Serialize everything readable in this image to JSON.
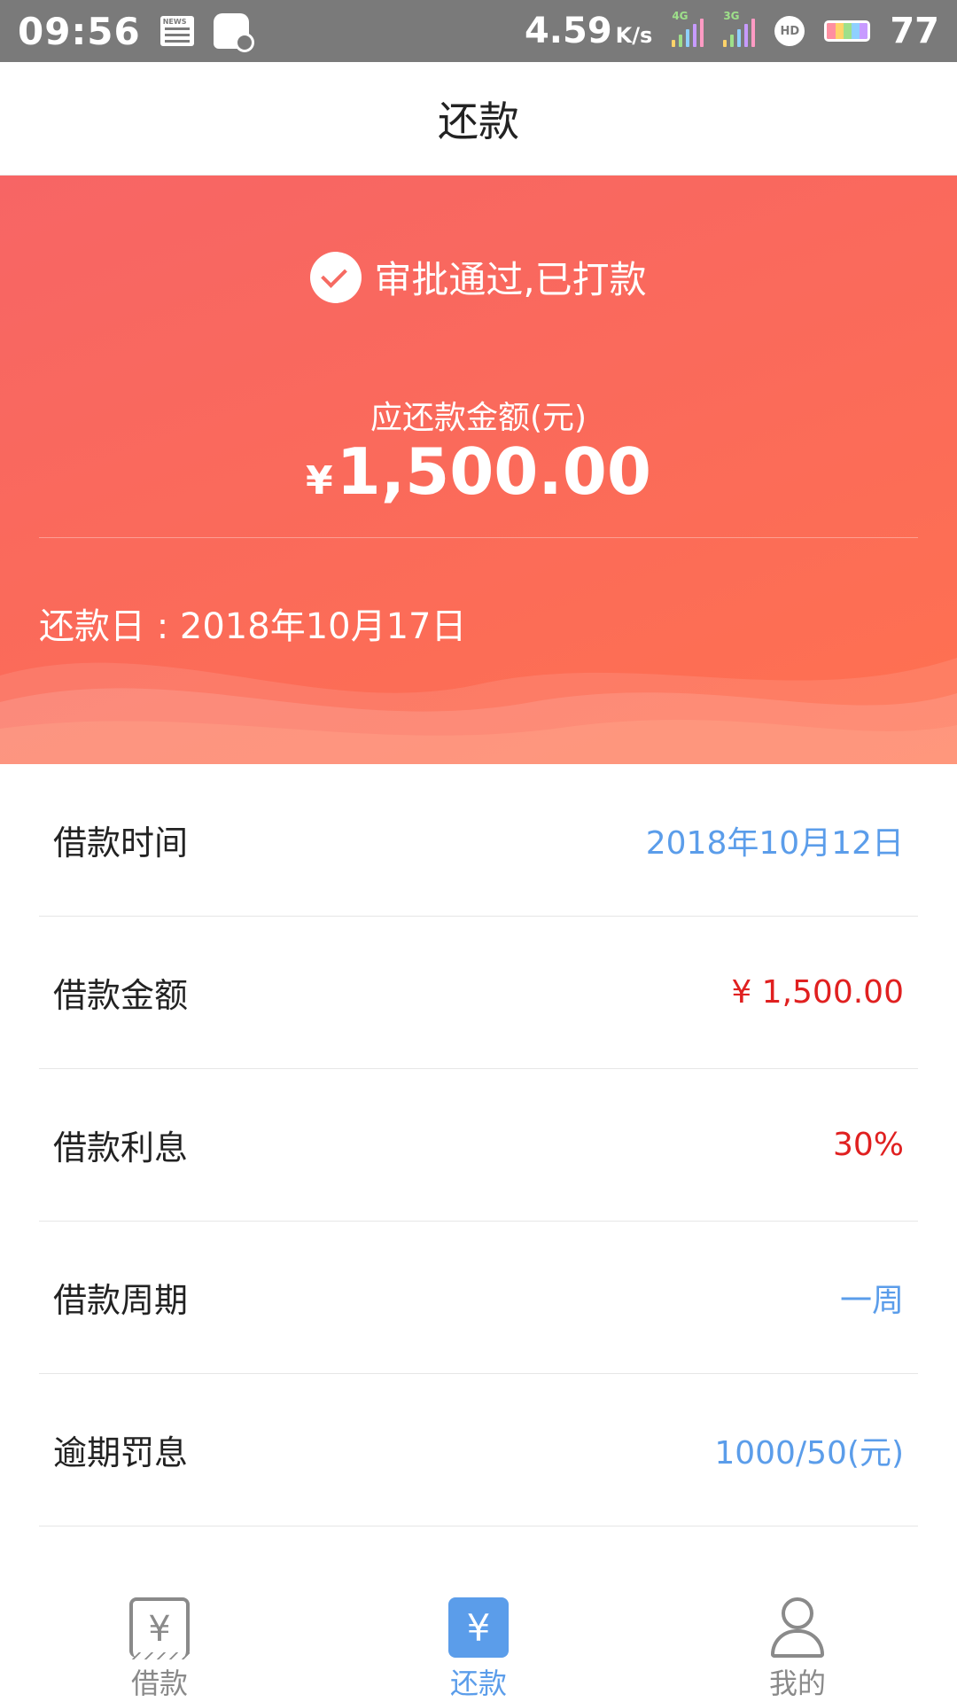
{
  "status_bar": {
    "time": "09:56",
    "news_label": "NEWS",
    "speed": "4.59",
    "speed_unit": "K/s",
    "net1": "4G",
    "net2": "3G",
    "hd": "HD",
    "battery_level": "77"
  },
  "header": {
    "title": "还款"
  },
  "hero": {
    "status_text": "审批通过,已打款",
    "amount_label": "应还款金额(元)",
    "amount_currency": "¥",
    "amount_value": "1,500.00",
    "repay_date": "还款日 : 2018年10月17日",
    "gradient_start": "#f76565",
    "gradient_end": "#ff7150"
  },
  "details": [
    {
      "label": "借款时间",
      "value": "2018年10月12日",
      "color": "#5b9dea"
    },
    {
      "label": "借款金额",
      "value": "¥ 1,500.00",
      "color": "#e02020"
    },
    {
      "label": "借款利息",
      "value": "30%",
      "color": "#e02020"
    },
    {
      "label": "借款周期",
      "value": "一周",
      "color": "#5b9dea"
    },
    {
      "label": "逾期罚息",
      "value": "1000/50(元)",
      "color": "#5b9dea"
    }
  ],
  "tabbar": {
    "tabs": [
      {
        "label": "借款",
        "icon": "receipt-yen-icon",
        "active": false
      },
      {
        "label": "还款",
        "icon": "yen-icon",
        "active": true
      },
      {
        "label": "我的",
        "icon": "user-icon",
        "active": false
      }
    ],
    "active_color": "#5b9dea",
    "inactive_color": "#8a8a8a",
    "yen_glyph": "¥"
  }
}
